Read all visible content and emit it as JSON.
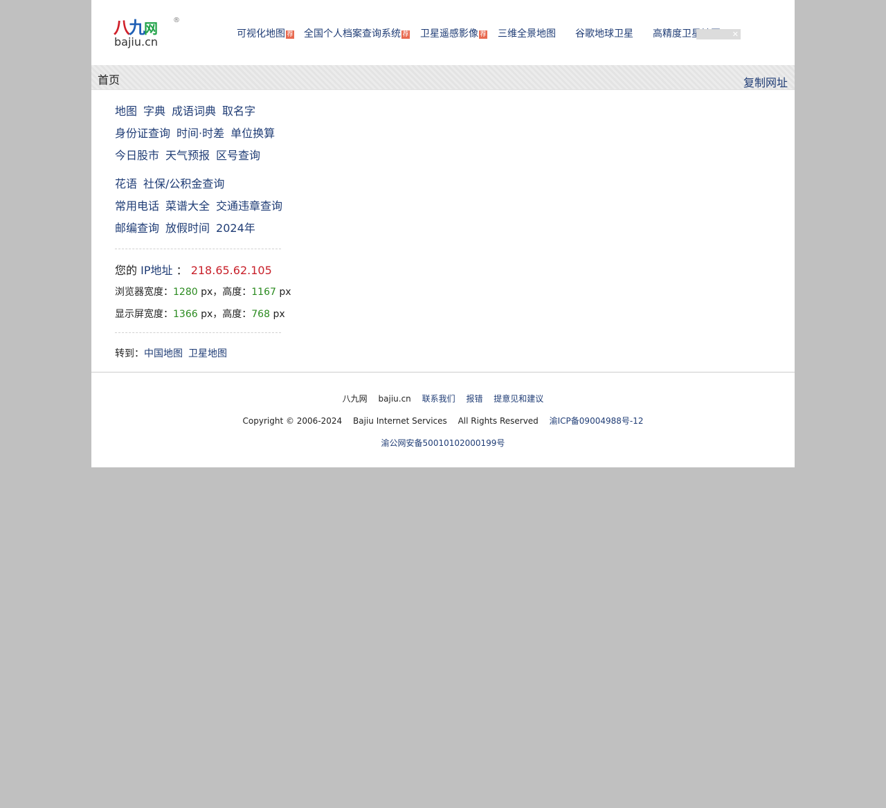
{
  "header": {
    "logo": {
      "chars": [
        "八",
        "九",
        "网"
      ],
      "domain": "bajiu.cn",
      "reg": "®"
    },
    "nav": [
      {
        "label": "可视化地图",
        "badge": "荐"
      },
      {
        "label": "全国个人档案查询系统",
        "badge": "荐"
      },
      {
        "label": "卫星遥感影像",
        "badge": "荐"
      },
      {
        "label": "三维全景地图"
      },
      {
        "label": "谷歌地球卫星"
      },
      {
        "label": "高精度卫星地图"
      }
    ],
    "ad_close": "✕"
  },
  "breadcrumb": {
    "home": "首页",
    "copy_url": "复制网址"
  },
  "links": {
    "row1": [
      "地图",
      "字典",
      "成语词典",
      "取名字"
    ],
    "row2": [
      "身份证查询",
      "时间·时差",
      "单位换算"
    ],
    "row3": [
      "今日股市",
      "天气预报",
      "区号查询"
    ],
    "row4": [
      "花语",
      "社保/公积金查询"
    ],
    "row5": [
      "常用电话",
      "菜谱大全",
      "交通违章查询"
    ],
    "row6": [
      "邮编查询",
      "放假时间",
      "2024年"
    ]
  },
  "info": {
    "ip_prefix": "您的",
    "ip_label": "IP地址",
    "ip_sep": "：",
    "ip_value": "218.65.62.105",
    "browser_label": "浏览器宽度：",
    "browser_width": "1280",
    "height_label": "高度：",
    "browser_height": "1167",
    "px_unit": "px",
    "px_unit_comma": "px，",
    "screen_label": "显示屏宽度：",
    "screen_width": "1366",
    "screen_height": "768"
  },
  "goto": {
    "label": "转到：",
    "links": [
      "中国地图",
      "卫星地图"
    ]
  },
  "footer": {
    "row1": {
      "name": "八九网",
      "domain": "bajiu.cn",
      "links": [
        "联系我们",
        "报错",
        "提意见和建议"
      ]
    },
    "row2": {
      "copyright": "Copyright © 2006-2024",
      "company": "Bajiu Internet Services",
      "rights": "All Rights Reserved",
      "icp": "渝ICP备09004988号-12"
    },
    "row3": {
      "police": "渝公网安备50010102000199号"
    }
  }
}
